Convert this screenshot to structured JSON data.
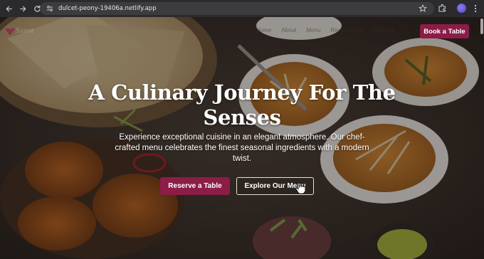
{
  "browser": {
    "url": "dulcet-peony-19406a.netlify.app",
    "icons": [
      "back-arrow-icon",
      "forward-arrow-icon",
      "reload-icon",
      "site-info-icon",
      "bookmark-star-icon",
      "extensions-icon",
      "profile-avatar",
      "menu-kebab-icon"
    ]
  },
  "site": {
    "logo_text": "Savor",
    "nav_links": [
      "Home",
      "About",
      "Menu",
      "Reservations",
      "Contact"
    ],
    "book_button": "Book a Table"
  },
  "hero": {
    "title": "A Culinary Journey For The Senses",
    "subtitle": "Experience exceptional cuisine in an elegant atmosphere. Our chef-crafted menu celebrates the finest seasonal ingredients with a modern twist.",
    "primary_button": "Reserve a Table",
    "secondary_button": "Explore Our Menu"
  },
  "colors": {
    "brand": "#8b1d47",
    "chrome": "#2b2b2d",
    "urlbar": "#3c3c3f"
  }
}
